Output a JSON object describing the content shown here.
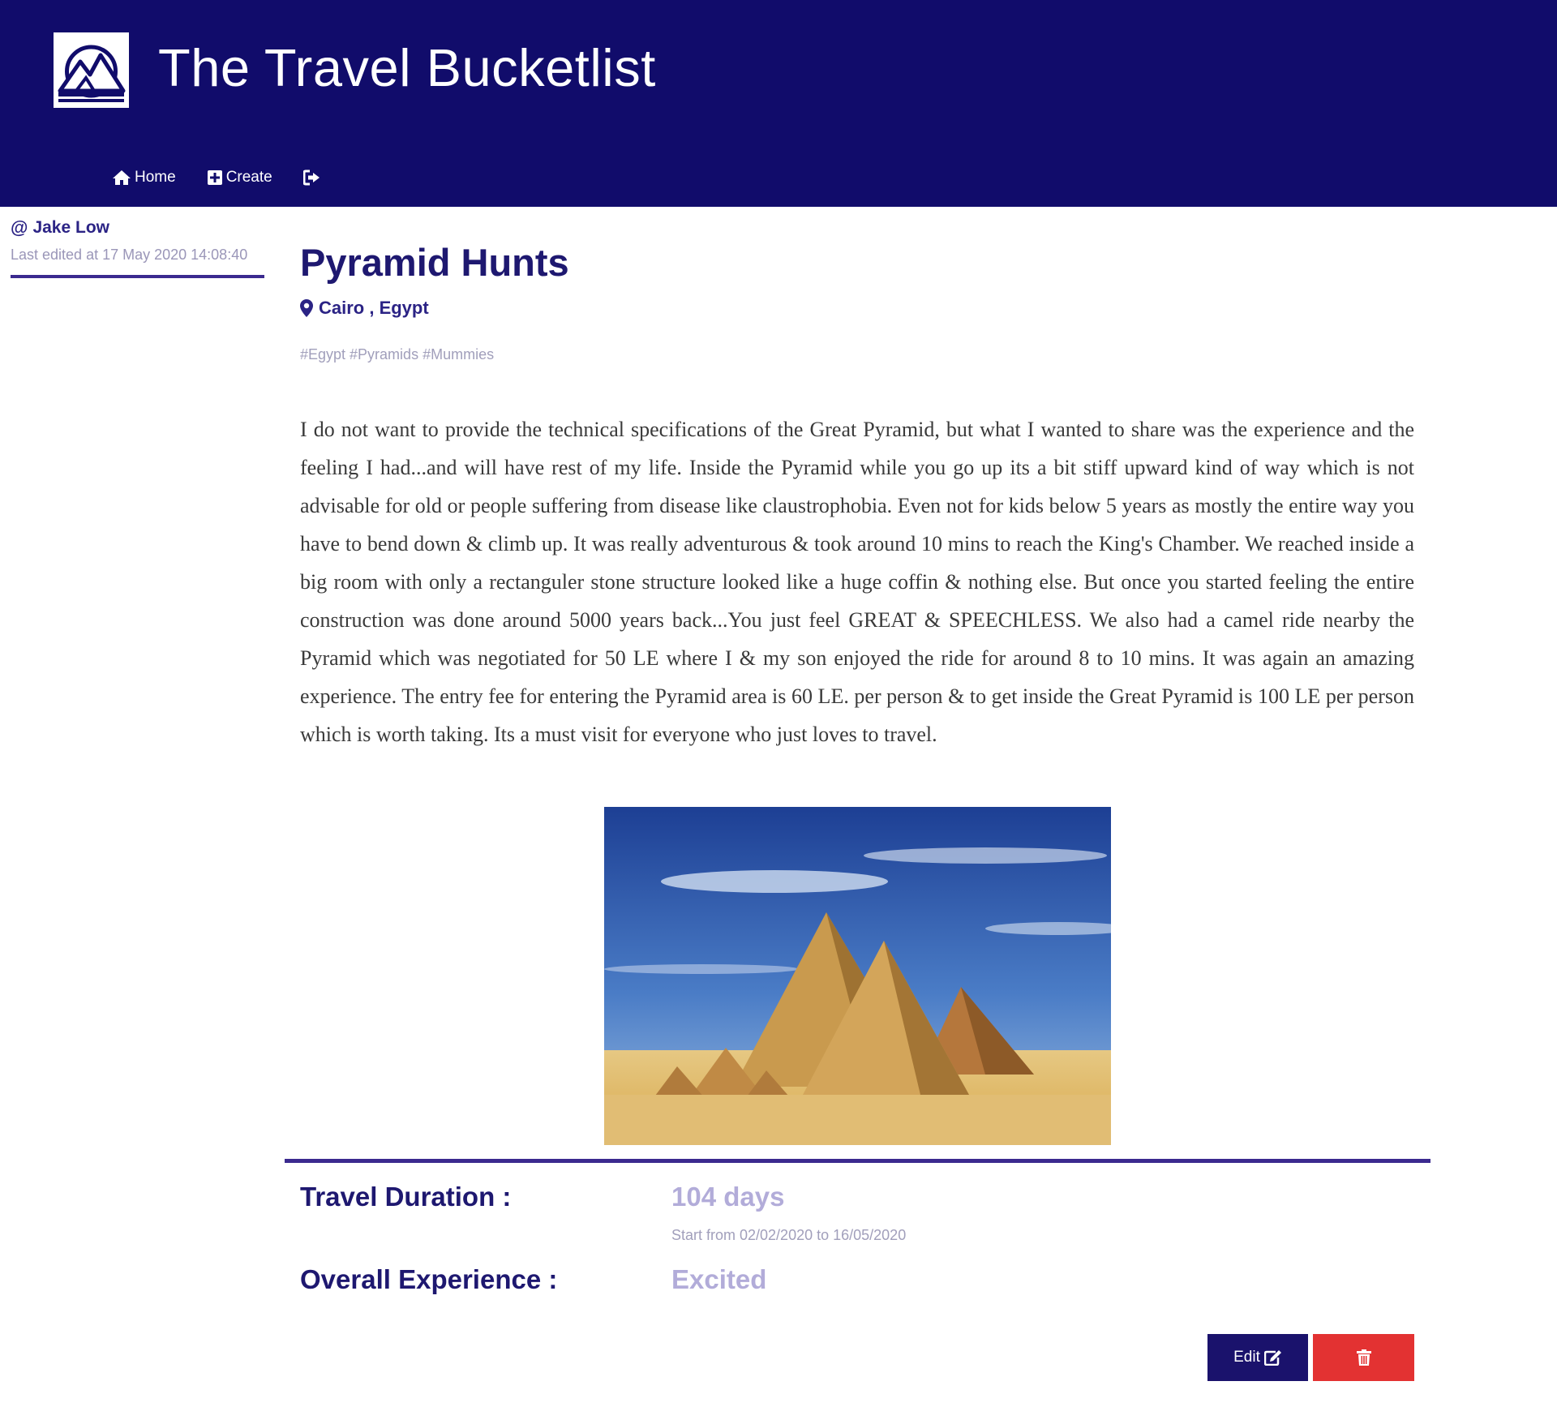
{
  "header": {
    "title": "The Travel Bucketlist",
    "logo_icon": "mountain-sun-logo",
    "nav": [
      {
        "label": "Home",
        "icon": "home-icon"
      },
      {
        "label": "Create",
        "icon": "plus-square-icon"
      },
      {
        "label": "",
        "icon": "sign-out-icon"
      }
    ]
  },
  "sidebar": {
    "author_prefix": "@",
    "author": "Jake Low",
    "last_edited": "Last edited at 17 May 2020 14:08:40"
  },
  "post": {
    "title": "Pyramid Hunts",
    "location": "Cairo , Egypt",
    "tags": "#Egypt #Pyramids #Mummies",
    "body": "I do not want to provide the technical specifications of the Great Pyramid, but what I wanted to share was the experience and the feeling I had...and will have rest of my life. Inside the Pyramid while you go up its a bit stiff upward kind of way which is not advisable for old or people suffering from disease like claustrophobia. Even not for kids below 5 years as mostly the entire way you have to bend down & climb up. It was really adventurous & took around 10 mins to reach the King's Chamber. We reached inside a big room with only a rectanguler stone structure looked like a huge coffin & nothing else. But once you started feeling the entire construction was done around 5000 years back...You just feel GREAT & SPEECHLESS. We also had a camel ride nearby the Pyramid which was negotiated for 50 LE where I & my son enjoyed the ride for around 8 to 10 mins. It was again an amazing experience. The entry fee for entering the Pyramid area is 60 LE. per person & to get inside the Great Pyramid is 100 LE per person which is worth taking. Its a must visit for everyone who just loves to travel."
  },
  "details": {
    "duration_label": "Travel Duration :",
    "duration_value": "104 days",
    "duration_range": "Start from 02/02/2020 to 16/05/2020",
    "experience_label": "Overall Experience :",
    "experience_value": "Excited"
  },
  "actions": {
    "edit_label": "Edit",
    "edit_icon": "edit-icon",
    "delete_icon": "trash-icon"
  },
  "colors": {
    "header_bg": "#110c6b",
    "accent": "#3b2a8f",
    "delete": "#e33232"
  }
}
